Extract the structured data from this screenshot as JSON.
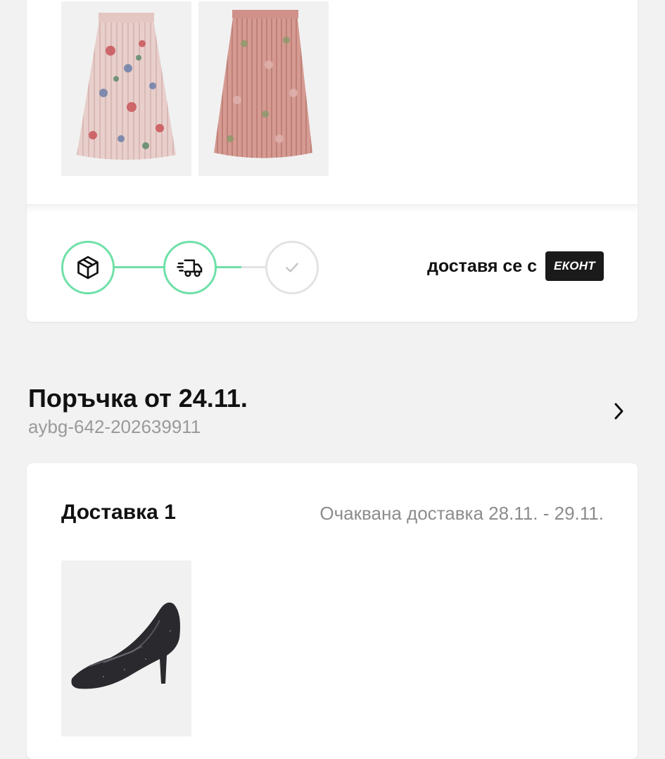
{
  "shipment": {
    "products": [
      {
        "name": "skirt-floral-light",
        "color": "#e6c9c6"
      },
      {
        "name": "skirt-floral-dusty-pink",
        "color": "#d79a94"
      }
    ],
    "tracking_steps": [
      {
        "icon": "package-icon",
        "state": "done"
      },
      {
        "icon": "truck-fast-icon",
        "state": "done"
      },
      {
        "icon": "check-icon",
        "state": "pending"
      }
    ],
    "delivered_by_label": "доставя се с",
    "carrier": "ЕКОНТ",
    "accent_color": "#6fe0a8"
  },
  "order": {
    "title": "Поръчка от 24.11.",
    "id": "aybg-642-202639911",
    "chevron_icon": "chevron-right-icon"
  },
  "delivery": {
    "title": "Доставка 1",
    "expected": "Очаквана доставка 28.11. - 29.11.",
    "products": [
      {
        "name": "black-glitter-pump",
        "color": "#2a2a2e"
      }
    ]
  }
}
